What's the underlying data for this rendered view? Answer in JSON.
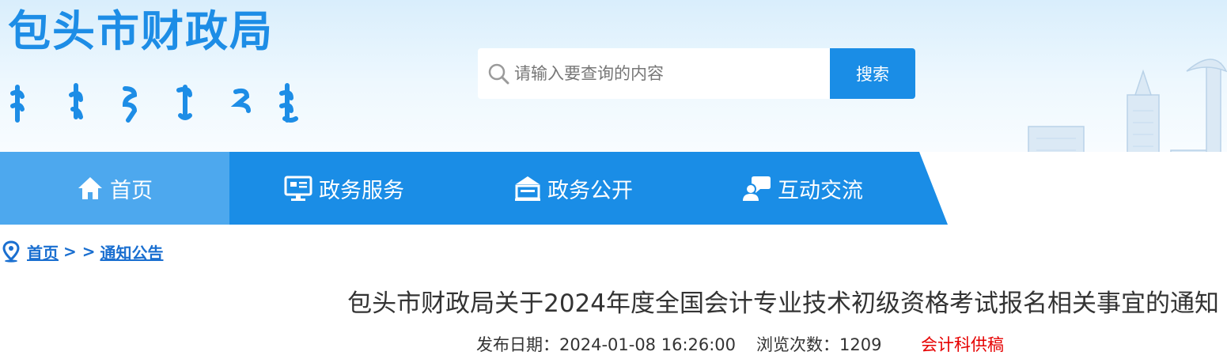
{
  "header": {
    "site_title": "包头市财政局",
    "search": {
      "placeholder": "请输入要查询的内容",
      "button_label": "搜索"
    }
  },
  "nav": {
    "items": [
      {
        "label": "首页",
        "icon": "home-icon",
        "active": true
      },
      {
        "label": "政务服务",
        "icon": "monitor-icon"
      },
      {
        "label": "政务公开",
        "icon": "building-icon"
      },
      {
        "label": "互动交流",
        "icon": "chat-user-icon"
      }
    ]
  },
  "breadcrumb": {
    "home": "首页",
    "separator": "> >",
    "current": "通知公告"
  },
  "article": {
    "title": "包头市财政局关于2024年度全国会计专业技术初级资格考试报名相关事宜的通知",
    "publish_label": "发布日期：2024-01-08 16:26:00",
    "views_label": "浏览次数：1209",
    "source": "会计科供稿"
  },
  "colors": {
    "brand": "#1a8de6",
    "nav_active": "#4da8ee",
    "source": "#e60000"
  }
}
